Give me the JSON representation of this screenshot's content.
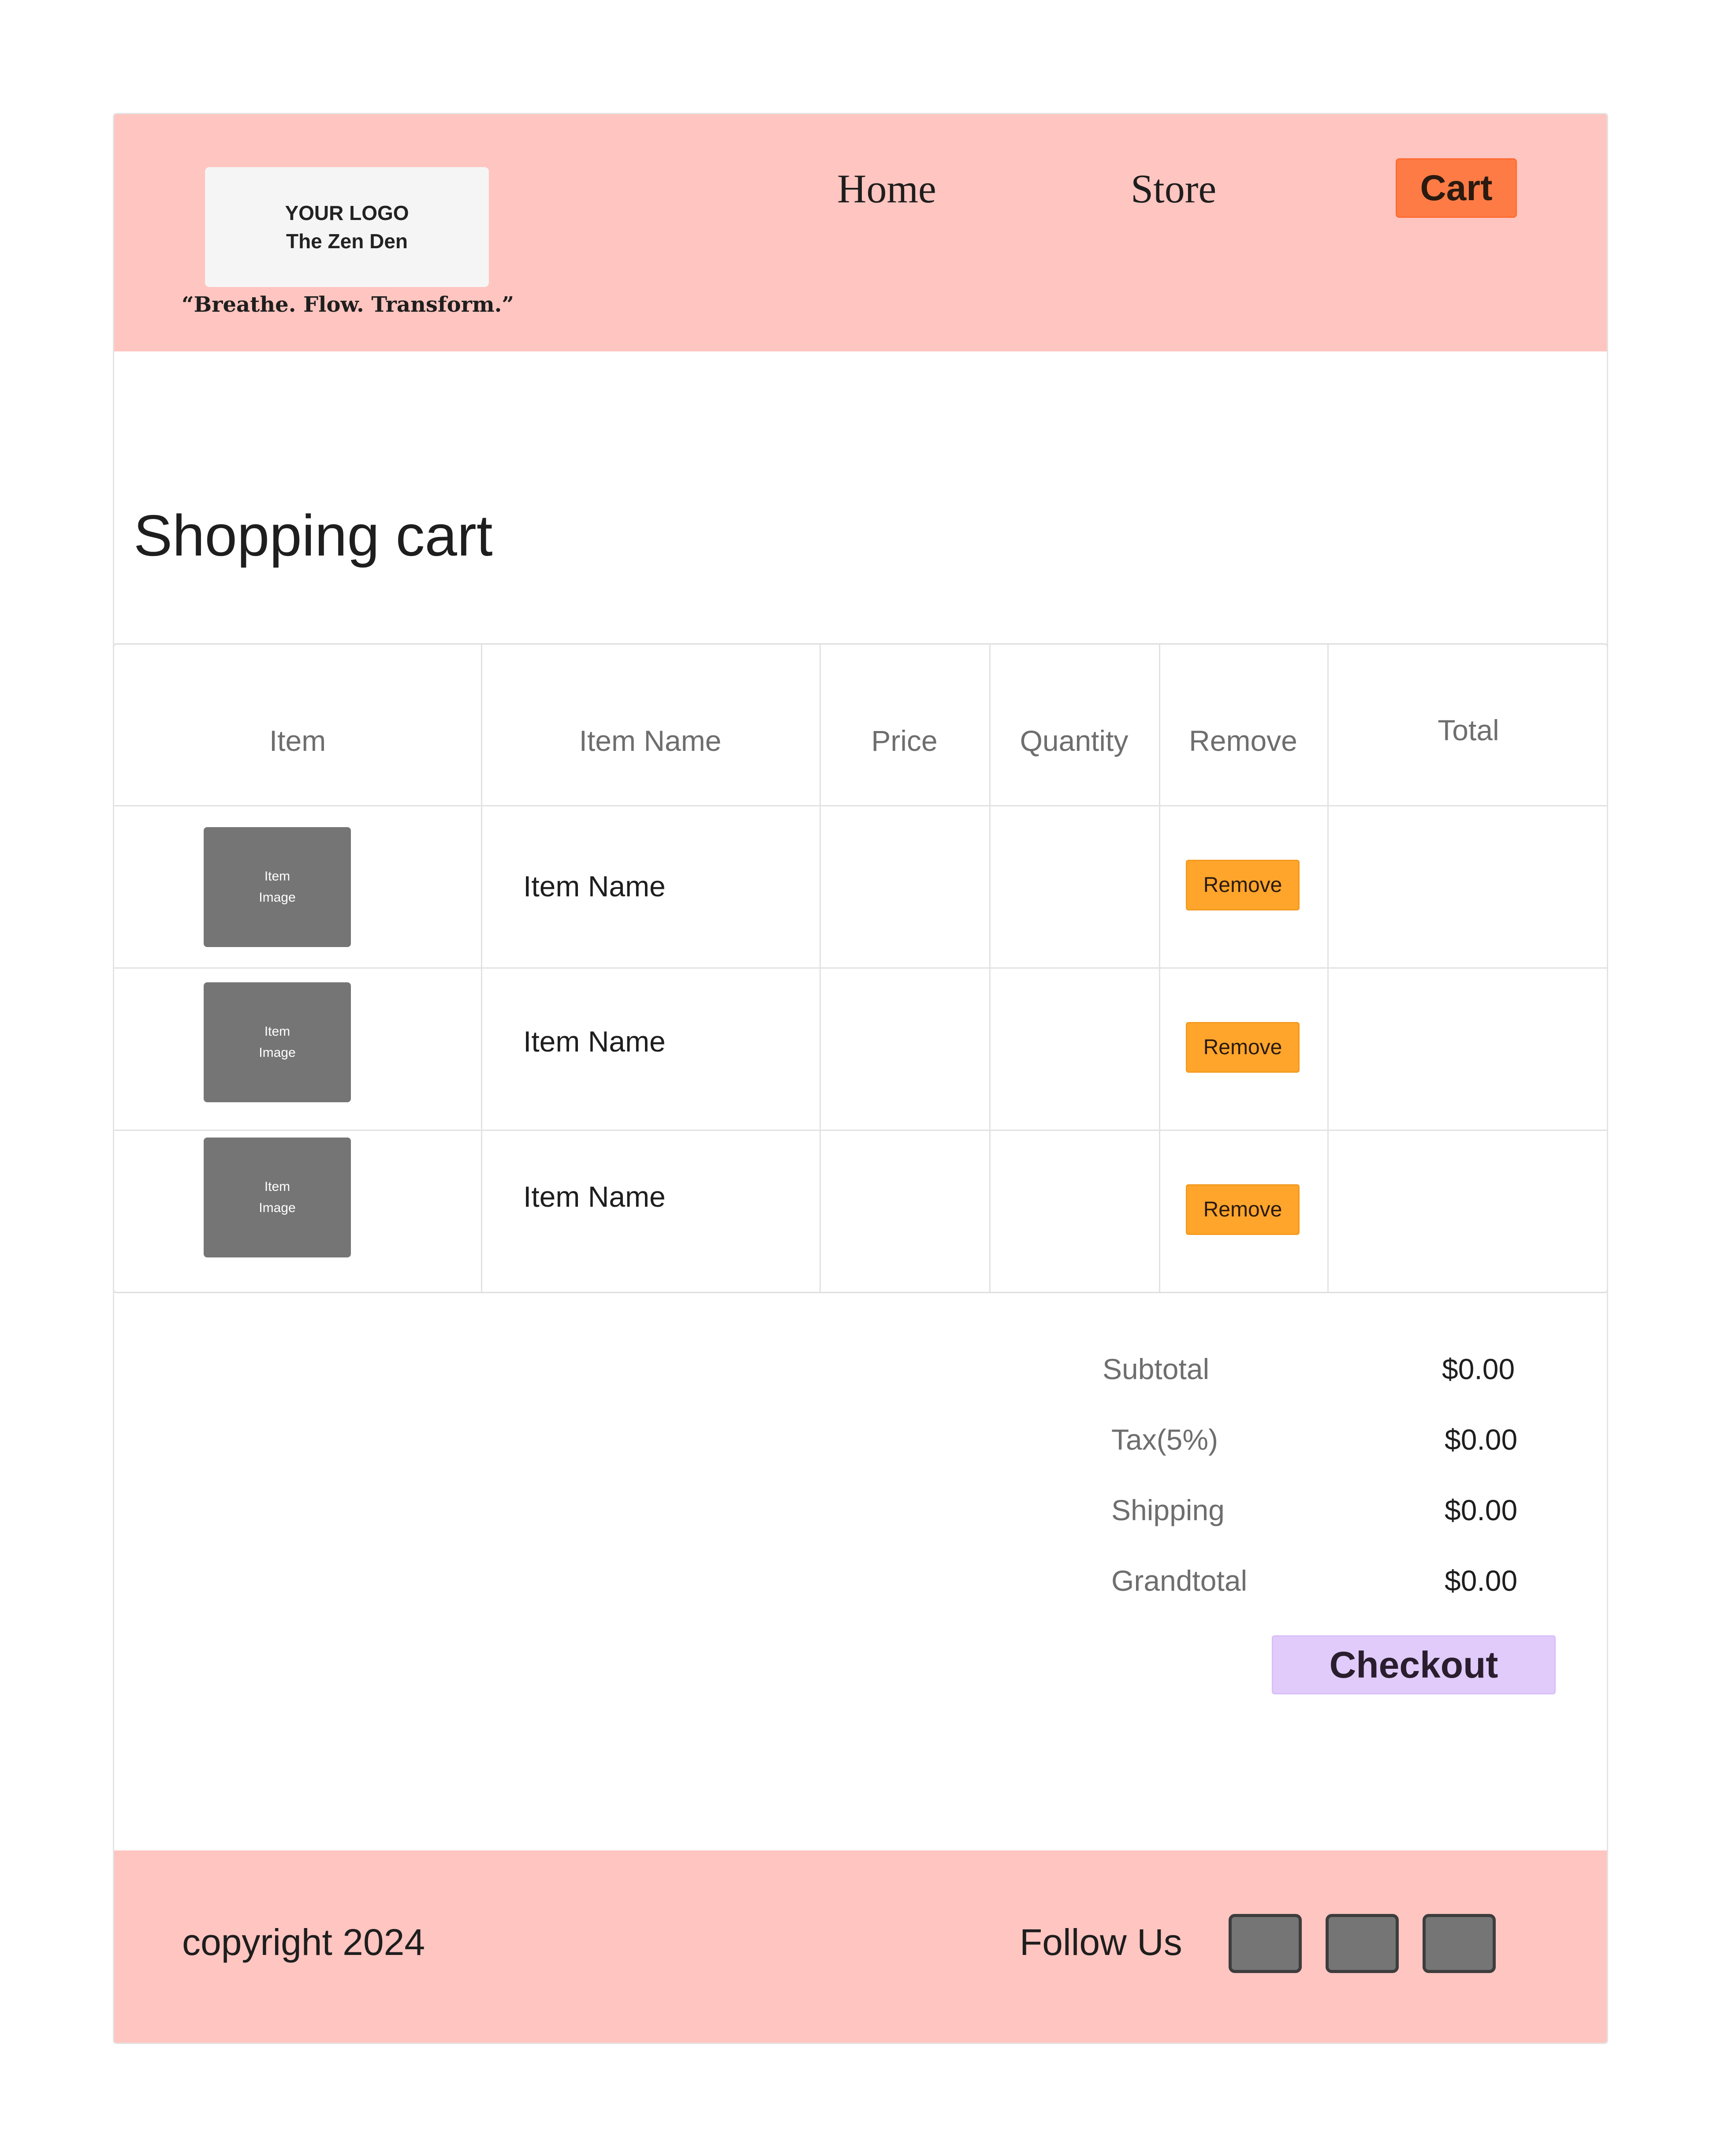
{
  "header": {
    "logo_line1": "YOUR LOGO",
    "logo_line2": "The Zen Den",
    "tagline": "“Breathe. Flow. Transform.”",
    "nav": {
      "home": "Home",
      "store": "Store",
      "cart": "Cart"
    }
  },
  "colors": {
    "header_bg": "#ffc5c0",
    "cart_button": "#ff7b45",
    "remove_button": "#ffa52b",
    "checkout_button": "#e1cbfb",
    "image_placeholder": "#757575"
  },
  "page_title": "Shopping cart",
  "table": {
    "headers": [
      "Item",
      "Item Name",
      "Price",
      "Quantity",
      "Remove",
      "Total"
    ],
    "rows": [
      {
        "image_text_1": "Item",
        "image_text_2": "Image",
        "name": "Item Name",
        "price": "",
        "quantity": "",
        "remove_label": "Remove",
        "total": ""
      },
      {
        "image_text_1": "Item",
        "image_text_2": "Image",
        "name": "Item Name",
        "price": "",
        "quantity": "",
        "remove_label": "Remove",
        "total": ""
      },
      {
        "image_text_1": "Item",
        "image_text_2": "Image",
        "name": "Item Name",
        "price": "",
        "quantity": "",
        "remove_label": "Remove",
        "total": ""
      }
    ]
  },
  "summary": {
    "subtotal_label": "Subtotal",
    "subtotal_value": "$0.00",
    "tax_label": "Tax(5%)",
    "tax_value": "$0.00",
    "shipping_label": "Shipping",
    "shipping_value": "$0.00",
    "grandtotal_label": "Grandtotal",
    "grandtotal_value": "$0.00",
    "checkout_label": "Checkout"
  },
  "footer": {
    "copyright": "copyright  2024",
    "follow_label": "Follow Us",
    "social_icons": [
      "social-icon-1",
      "social-icon-2",
      "social-icon-3"
    ]
  }
}
